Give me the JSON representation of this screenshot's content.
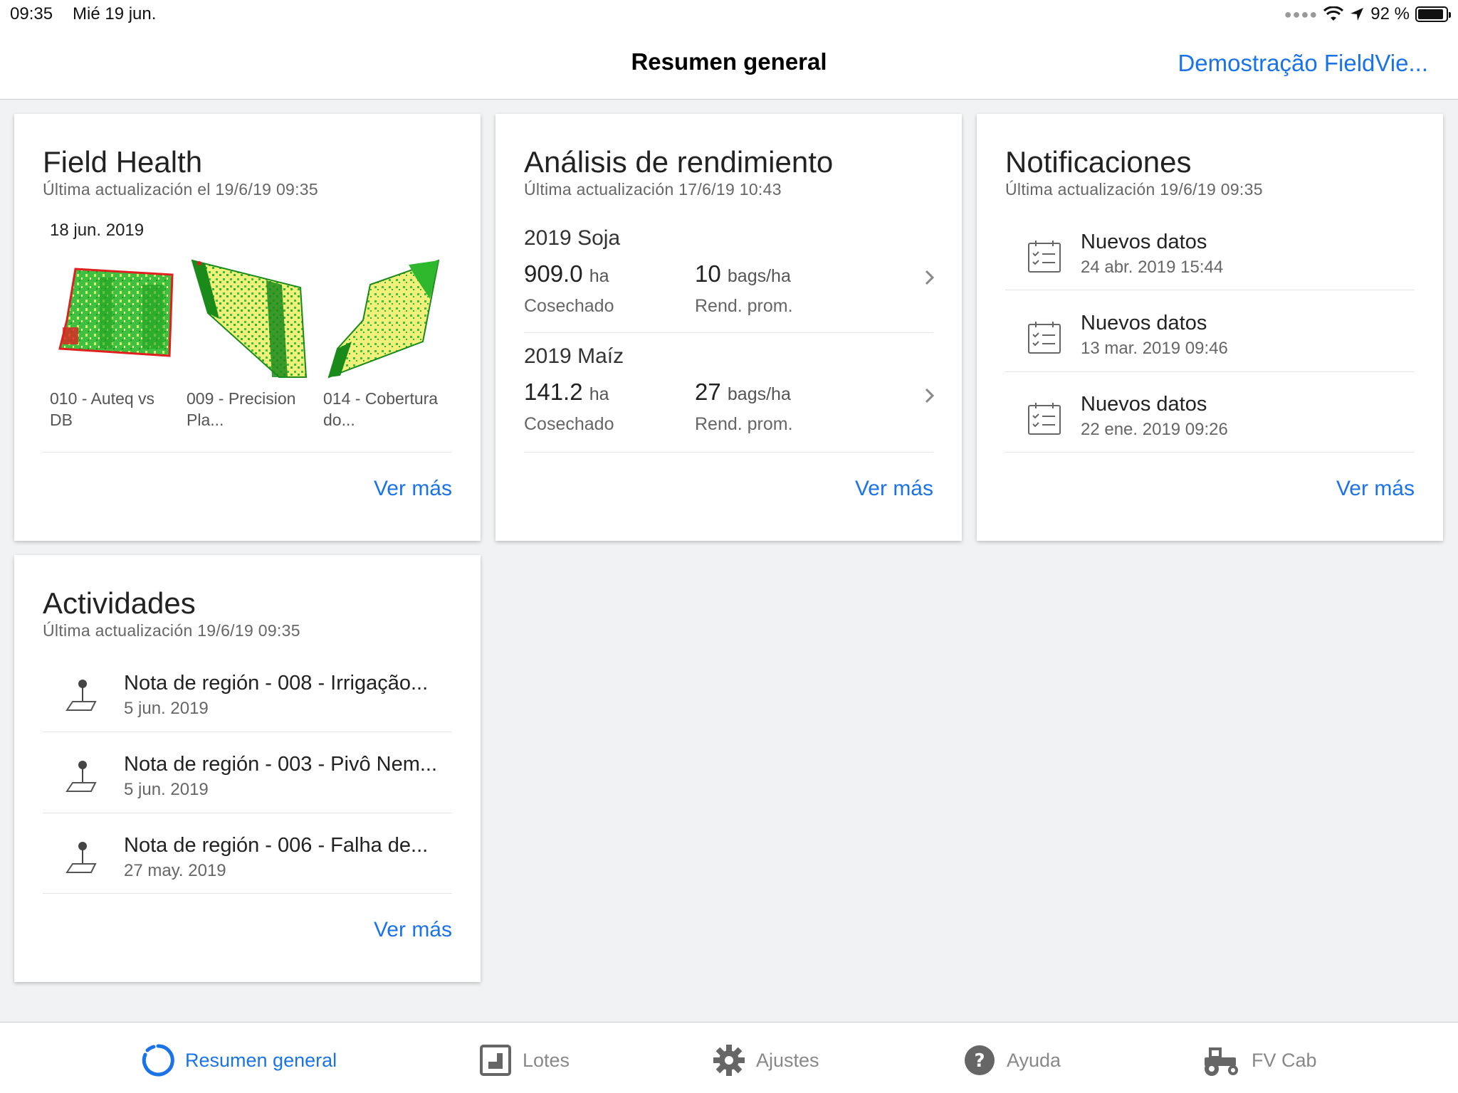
{
  "status_bar": {
    "time": "09:35",
    "date": "Mié 19 jun.",
    "battery": "92 %"
  },
  "nav": {
    "title": "Resumen general",
    "account": "Demostração FieldVie..."
  },
  "field_health": {
    "title": "Field Health",
    "updated": "Última actualización el 19/6/19 09:35",
    "date": "18 jun. 2019",
    "fields": [
      {
        "name": "010 - Auteq vs DB"
      },
      {
        "name": "009 - Precision Pla..."
      },
      {
        "name": "014 - Cobertura do..."
      }
    ],
    "more": "Ver más"
  },
  "yield": {
    "title": "Análisis de rendimiento",
    "updated": "Última actualización 17/6/19 10:43",
    "crops": [
      {
        "name": "2019 Soja",
        "area": "909.0",
        "area_unit": "ha",
        "area_label": "Cosechado",
        "yield": "10",
        "yield_unit": "bags/ha",
        "yield_label": "Rend. prom."
      },
      {
        "name": "2019 Maíz",
        "area": "141.2",
        "area_unit": "ha",
        "area_label": "Cosechado",
        "yield": "27",
        "yield_unit": "bags/ha",
        "yield_label": "Rend. prom."
      }
    ],
    "more": "Ver más"
  },
  "notifications": {
    "title": "Notificaciones",
    "updated": "Última actualización 19/6/19 09:35",
    "items": [
      {
        "title": "Nuevos datos",
        "date": "24 abr. 2019 15:44",
        "icon": "checklist-icon"
      },
      {
        "title": "Nuevos datos",
        "date": "13 mar. 2019 09:46",
        "icon": "checklist-icon"
      },
      {
        "title": "Nuevos datos",
        "date": "22 ene. 2019 09:26",
        "icon": "checklist-icon"
      }
    ],
    "more": "Ver más"
  },
  "activities": {
    "title": "Actividades",
    "updated": "Última actualización 19/6/19 09:35",
    "items": [
      {
        "title": "Nota de región - 008 - Irrigação...",
        "date": "5 jun. 2019",
        "icon": "map-pin-icon"
      },
      {
        "title": "Nota de región - 003 - Pivô Nem...",
        "date": "5 jun. 2019",
        "icon": "map-pin-icon"
      },
      {
        "title": "Nota de región - 006 - Falha de...",
        "date": "27 may. 2019",
        "icon": "map-pin-icon"
      }
    ],
    "more": "Ver más"
  },
  "tabs": [
    {
      "label": "Resumen general",
      "icon": "overview-ring-icon",
      "active": true
    },
    {
      "label": "Lotes",
      "icon": "fields-icon",
      "active": false
    },
    {
      "label": "Ajustes",
      "icon": "gear-icon",
      "active": false
    },
    {
      "label": "Ayuda",
      "icon": "help-icon",
      "active": false
    },
    {
      "label": "FV Cab",
      "icon": "tractor-icon",
      "active": false
    }
  ],
  "colors": {
    "accent": "#1a73e8",
    "background": "#f0f2f4",
    "health_green": "#2eb82e",
    "health_yellow": "#f2f07a",
    "health_red": "#e02020"
  }
}
